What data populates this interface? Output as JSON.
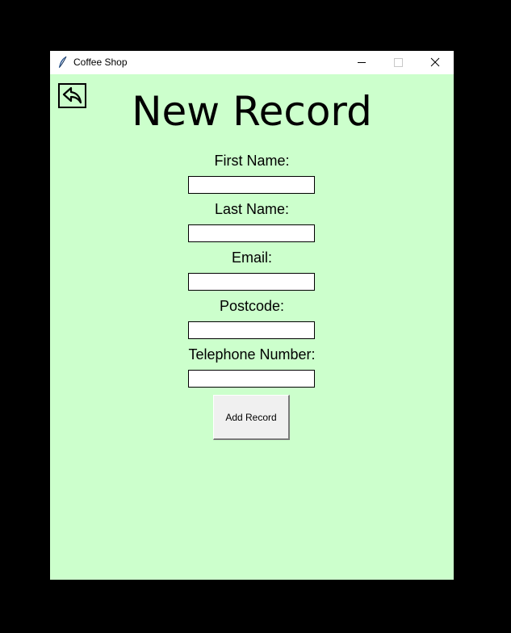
{
  "window": {
    "title": "Coffee Shop",
    "app_icon": "feather-icon",
    "controls": {
      "minimize_icon": "minimize-icon",
      "maximize_icon": "maximize-icon",
      "close_icon": "close-icon"
    }
  },
  "colors": {
    "background": "#ccffcc",
    "screen_background": "#000000",
    "button_face": "#f0f0f0"
  },
  "header": {
    "back_icon": "back-arrow-icon",
    "title": "New Record"
  },
  "form": {
    "fields": [
      {
        "label": "First Name:",
        "value": ""
      },
      {
        "label": "Last Name:",
        "value": ""
      },
      {
        "label": "Email:",
        "value": ""
      },
      {
        "label": "Postcode:",
        "value": ""
      },
      {
        "label": "Telephone Number:",
        "value": ""
      }
    ],
    "submit_label": "Add Record"
  }
}
